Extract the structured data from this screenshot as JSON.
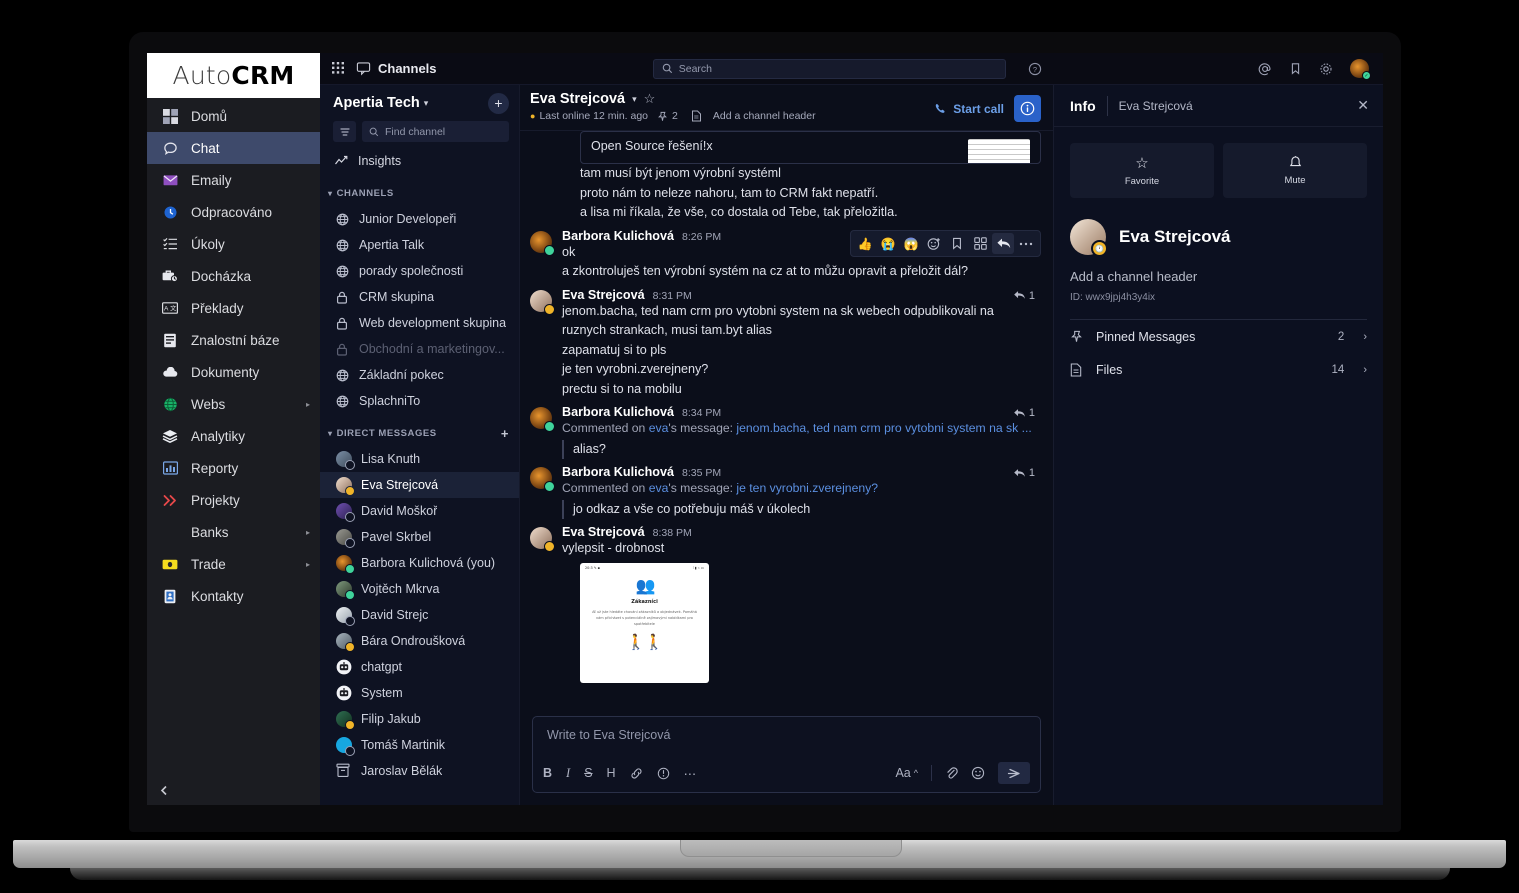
{
  "brand": {
    "logo_thin": "Auto",
    "logo_bold": "CRM",
    "collapse_icon": "chevron-left"
  },
  "nav": {
    "items": [
      {
        "label": "Domů",
        "icon": "grid-icon",
        "active": false,
        "caret": ""
      },
      {
        "label": "Chat",
        "icon": "chat-bubble-icon",
        "active": true,
        "caret": ""
      },
      {
        "label": "Emaily",
        "icon": "envelope-icon",
        "active": false,
        "caret": ""
      },
      {
        "label": "Odpracováno",
        "icon": "clock-icon",
        "active": false,
        "caret": ""
      },
      {
        "label": "Úkoly",
        "icon": "tasklist-icon",
        "active": false,
        "caret": ""
      },
      {
        "label": "Docházka",
        "icon": "briefcase-icon",
        "active": false,
        "caret": ""
      },
      {
        "label": "Překlady",
        "icon": "translate-icon",
        "active": false,
        "caret": ""
      },
      {
        "label": "Znalostní báze",
        "icon": "book-icon",
        "active": false,
        "caret": ""
      },
      {
        "label": "Dokumenty",
        "icon": "cloud-icon",
        "active": false,
        "caret": ""
      },
      {
        "label": "Webs",
        "icon": "globe-icon",
        "active": false,
        "caret": "▸"
      },
      {
        "label": "Analytiky",
        "icon": "layers-icon",
        "active": false,
        "caret": ""
      },
      {
        "label": "Reporty",
        "icon": "barchart-icon",
        "active": false,
        "caret": ""
      },
      {
        "label": "Projekty",
        "icon": "chevrons-icon",
        "active": false,
        "caret": ""
      },
      {
        "label": "Banks",
        "icon": "blank-icon",
        "active": false,
        "caret": "▸"
      },
      {
        "label": "Trade",
        "icon": "money-icon",
        "active": false,
        "caret": "▸"
      },
      {
        "label": "Kontakty",
        "icon": "contact-card-icon",
        "active": false,
        "caret": ""
      }
    ]
  },
  "global_bar": {
    "apps_icon": "apps-grid-icon",
    "section_icon": "channels-icon",
    "section_label": "Channels",
    "search_placeholder": "Search",
    "help_icon": "help-circle-icon",
    "right_icons": [
      "at-mention-icon",
      "bookmark-icon",
      "gear-icon"
    ],
    "avatar_status": "online"
  },
  "channel_panel": {
    "team_name": "Apertia Tech",
    "team_chevron": "chevron-down-icon",
    "add_label": "+",
    "filter_icon": "filter-icon",
    "find_placeholder": "Find channel",
    "insights_label": "Insights",
    "channels_section": "CHANNELS",
    "channels": [
      {
        "label": "Junior Developeři",
        "icon": "globe",
        "muted": false,
        "selected": false
      },
      {
        "label": "Apertia Talk",
        "icon": "globe",
        "muted": false,
        "selected": false
      },
      {
        "label": "porady společnosti",
        "icon": "globe",
        "muted": false,
        "selected": false
      },
      {
        "label": "CRM skupina",
        "icon": "lock",
        "muted": false,
        "selected": false
      },
      {
        "label": "Web development skupina",
        "icon": "lock",
        "muted": false,
        "selected": false
      },
      {
        "label": "Obchodní a marketingov...",
        "icon": "lock",
        "muted": true,
        "selected": false
      },
      {
        "label": "Základní pokec",
        "icon": "globe",
        "muted": false,
        "selected": false
      },
      {
        "label": "SplachniTo",
        "icon": "globe",
        "muted": false,
        "selected": false
      }
    ],
    "dm_section": "DIRECT MESSAGES",
    "dm_add_label": "+",
    "dms": [
      {
        "label": "Lisa Knuth",
        "status": "offline",
        "selected": false,
        "av": "linear-gradient(135deg,#7b8fa6,#3f4c5c)"
      },
      {
        "label": "Eva Strejcová",
        "status": "away",
        "selected": true,
        "av": "linear-gradient(135deg,#f0ddcd,#8d6f5c)"
      },
      {
        "label": "David Moškoř",
        "status": "offline",
        "selected": false,
        "av": "linear-gradient(135deg,#6f4fb0,#2b2050)"
      },
      {
        "label": "Pavel Skrbel",
        "status": "offline",
        "selected": false,
        "av": "linear-gradient(135deg,#9a9a93,#4a4a45)"
      },
      {
        "label": "Barbora Kulichová (you)",
        "status": "online",
        "selected": false,
        "av": "radial-gradient(circle at 40% 40%,#e8952e,#7a4412 60%,#211a14)"
      },
      {
        "label": "Vojtěch Mkrva",
        "status": "online",
        "selected": false,
        "av": "linear-gradient(135deg,#7f9a7e,#2e3a2c)"
      },
      {
        "label": "David Strejc",
        "status": "offline",
        "selected": false,
        "av": "linear-gradient(135deg,#eef1f4,#98a3ad)"
      },
      {
        "label": "Bára Ondroušková",
        "status": "away",
        "selected": false,
        "av": "linear-gradient(135deg,#a8b4be,#4e5a63)"
      },
      {
        "label": "chatgpt",
        "status": "none",
        "selected": false,
        "av": "#0e1222",
        "icon": "robot"
      },
      {
        "label": "System",
        "status": "none",
        "selected": false,
        "av": "#0e1222",
        "icon": "robot"
      },
      {
        "label": "Filip Jakub",
        "status": "away",
        "selected": false,
        "av": "linear-gradient(135deg,#2f6f52,#12301f)"
      },
      {
        "label": "Tomáš Martinik",
        "status": "offline",
        "selected": false,
        "av": "#17a7e0"
      },
      {
        "label": "Jaroslav Bělák",
        "status": "none",
        "selected": false,
        "av": "#0e1222",
        "icon": "archive"
      }
    ]
  },
  "chat_header": {
    "title": "Eva Strejcová",
    "chevron_icon": "chevron-down-icon",
    "star_icon": "star-outline-icon",
    "presence_text": "Last online 12 min. ago",
    "pinned_icon": "pin-icon",
    "pinned_count": "2",
    "file_icon": "file-icon",
    "add_header_label": "Add a channel header",
    "start_call_label": "Start call",
    "phone_icon": "phone-icon",
    "info_icon": "info-circle-icon"
  },
  "messages": {
    "quote_text": "Open Source řešení!x",
    "preamble_lines": [
      "tam musí být jenom výrobní systéml",
      "proto nám to neleze nahoru, tam to CRM fakt nepatří.",
      "a lisa mi říkala, že vše, co dostala od Tebe, tak přeložitla."
    ],
    "hover_tools": [
      "👍",
      "😭",
      "😱",
      "emoji-plus-icon",
      "bookmark-icon",
      "apps-icon",
      "reply-icon",
      "more-icon"
    ],
    "list": [
      {
        "author": "Barbora Kulichová",
        "time": "8:26 PM",
        "status": "online",
        "av": "radial-gradient(circle at 40% 40%,#e8952e,#7a4412 60%,#211a14)",
        "lines": [
          "ok",
          "a zkontroluješ ten výrobní systém na cz at to můžu opravit a přeložit dál?"
        ],
        "replies": ""
      },
      {
        "author": "Eva Strejcová",
        "time": "8:31 PM",
        "status": "away",
        "av": "linear-gradient(135deg,#f0ddcd,#8d6f5c)",
        "lines": [
          "jenom.bacha, ted nam crm pro vytobni system na sk webech odpublikovali na ruznych strankach, musi tam.byt alias",
          "zapamatuj si to pls",
          "je ten vyrobni.zverejneny?",
          "prectu si to na mobilu"
        ],
        "replies": "1"
      },
      {
        "author": "Barbora Kulichová",
        "time": "8:34 PM",
        "status": "online",
        "av": "radial-gradient(circle at 40% 40%,#e8952e,#7a4412 60%,#211a14)",
        "comment_prefix": "Commented on ",
        "comment_user": "eva",
        "comment_mid": "'s message: ",
        "comment_target": "jenom.bacha, ted nam crm pro vytobni system na sk ...",
        "comment_body": "alias?",
        "replies": "1"
      },
      {
        "author": "Barbora Kulichová",
        "time": "8:35 PM",
        "status": "online",
        "av": "radial-gradient(circle at 40% 40%,#e8952e,#7a4412 60%,#211a14)",
        "comment_prefix": "Commented on ",
        "comment_user": "eva",
        "comment_mid": "'s message: ",
        "comment_target": "je ten vyrobni.zverejneny?",
        "comment_body": "jo odkaz a vše co potřebuju máš v úkolech",
        "replies": "1"
      },
      {
        "author": "Eva Strejcová",
        "time": "8:38 PM",
        "status": "away",
        "av": "linear-gradient(135deg,#f0ddcd,#8d6f5c)",
        "lines": [
          "vylepsit - drobnost"
        ],
        "replies": "",
        "attachment": {
          "status_left": "20:3 ✎ ▪",
          "status_right": "⁝ ▮ ⌁ ▭",
          "heading": "Zákazníci",
          "paragraph": "Ať už jste hledáte chování zákazníků a objednávek. Pomáhá vám přicházet s potenciálně zajímavými nabídkami pro spotřebitele",
          "people_icon": "two-people-icon",
          "footer_icon": "two-figures-icon"
        }
      }
    ]
  },
  "composer": {
    "placeholder": "Write to Eva Strejcová",
    "tools": [
      {
        "icon": "bold-icon",
        "label": "B"
      },
      {
        "icon": "italic-icon",
        "label": "I"
      },
      {
        "icon": "strikethrough-icon",
        "label": "S"
      },
      {
        "icon": "heading-icon",
        "label": "H"
      },
      {
        "icon": "link-icon",
        "label": "🔗"
      },
      {
        "icon": "info-icon",
        "label": "ⓘ"
      },
      {
        "icon": "more-icon",
        "label": "⋯"
      }
    ],
    "font_label": "Aa",
    "font_chevron": "^",
    "attach_icon": "paperclip-icon",
    "emoji_icon": "emoji-icon",
    "send_icon": "send-icon"
  },
  "info_panel": {
    "title": "Info",
    "subtitle": "Eva Strejcová",
    "close_icon": "close-icon",
    "actions": [
      {
        "label": "Favorite",
        "icon": "star-outline-icon"
      },
      {
        "label": "Mute",
        "icon": "bell-icon"
      }
    ],
    "name": "Eva Strejcová",
    "presence": "away",
    "add_header_label": "Add a channel header",
    "id_label": "ID: wwx9jpj4h3y4ix",
    "rows": [
      {
        "label": "Pinned Messages",
        "icon": "pin-icon",
        "count": "2",
        "chev": "›"
      },
      {
        "label": "Files",
        "icon": "file-icon",
        "count": "14",
        "chev": "›"
      }
    ]
  },
  "colors": {
    "accent_blue": "#2a62c9",
    "link_blue": "#5b8fe0",
    "active_nav": "#3e4a6b",
    "online_green": "#3fd39b",
    "away_yellow": "#f0b429",
    "sidebar_bg": "#1b1c21",
    "panel_bg": "#0e1222",
    "chat_bg": "#0b0e1a"
  }
}
